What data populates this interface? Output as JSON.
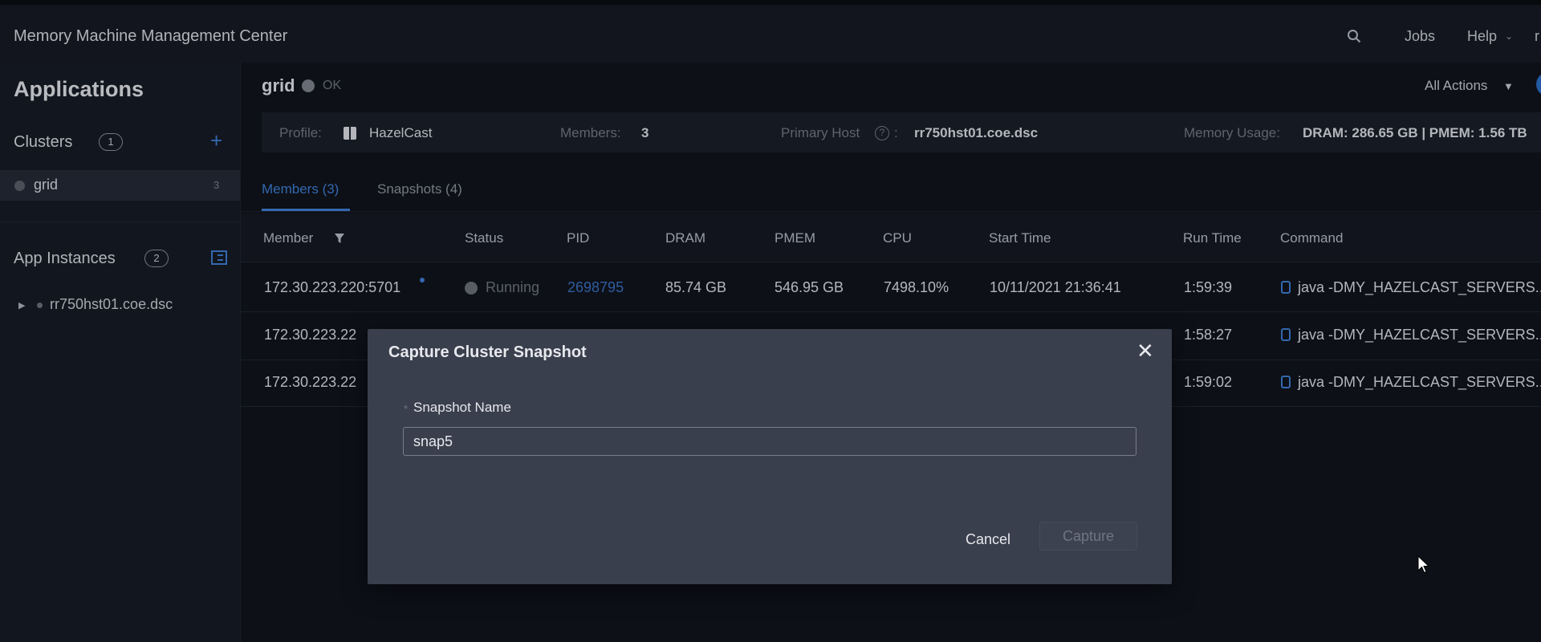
{
  "header": {
    "app_title": "Memory Machine Management Center",
    "jobs": "Jobs",
    "help": "Help",
    "user_initial": "r"
  },
  "sidebar": {
    "heading": "Applications",
    "clusters": {
      "label": "Clusters",
      "count": "1"
    },
    "cluster_items": [
      {
        "label": "grid",
        "count": "3"
      }
    ],
    "instances": {
      "label": "App Instances",
      "count": "2"
    },
    "instance_items": [
      {
        "label": "rr750hst01.coe.dsc"
      }
    ]
  },
  "main": {
    "title": "grid",
    "status": "OK",
    "all_actions": "All Actions",
    "info": {
      "profile_label": "Profile:",
      "profile_value": "HazelCast",
      "members_label": "Members:",
      "members_value": "3",
      "primary_host_label": "Primary Host",
      "primary_host_colon": ":",
      "primary_host_value": "rr750hst01.coe.dsc",
      "memory_usage_label": "Memory Usage:",
      "memory_usage_value": "DRAM: 286.65 GB | PMEM: 1.56 TB"
    },
    "tabs": [
      {
        "label": "Members (3)",
        "active": true
      },
      {
        "label": "Snapshots (4)",
        "active": false
      }
    ],
    "table": {
      "columns": [
        "Member",
        "Status",
        "PID",
        "DRAM",
        "PMEM",
        "CPU",
        "Start Time",
        "Run Time",
        "Command"
      ],
      "rows": [
        {
          "member": "172.30.223.220:5701",
          "status": "Running",
          "pid": "2698795",
          "dram": "85.74 GB",
          "pmem": "546.95 GB",
          "cpu": "7498.10%",
          "start_time": "10/11/2021 21:36:41",
          "run_time": "1:59:39",
          "command": "java -DMY_HAZELCAST_SERVERS..."
        },
        {
          "member": "172.30.223.22",
          "run_time": "1:58:27",
          "command": "java -DMY_HAZELCAST_SERVERS..."
        },
        {
          "member": "172.30.223.22",
          "run_time": "1:59:02",
          "command": "java -DMY_HAZELCAST_SERVERS..."
        }
      ]
    }
  },
  "modal": {
    "title": "Capture Cluster Snapshot",
    "required_mark": "*",
    "field_label": "Snapshot Name",
    "field_value": "snap5",
    "cancel": "Cancel",
    "capture": "Capture"
  },
  "colors": {
    "accent": "#3f7fd6",
    "background": "#11141d",
    "modal": "#3a3f4d"
  }
}
